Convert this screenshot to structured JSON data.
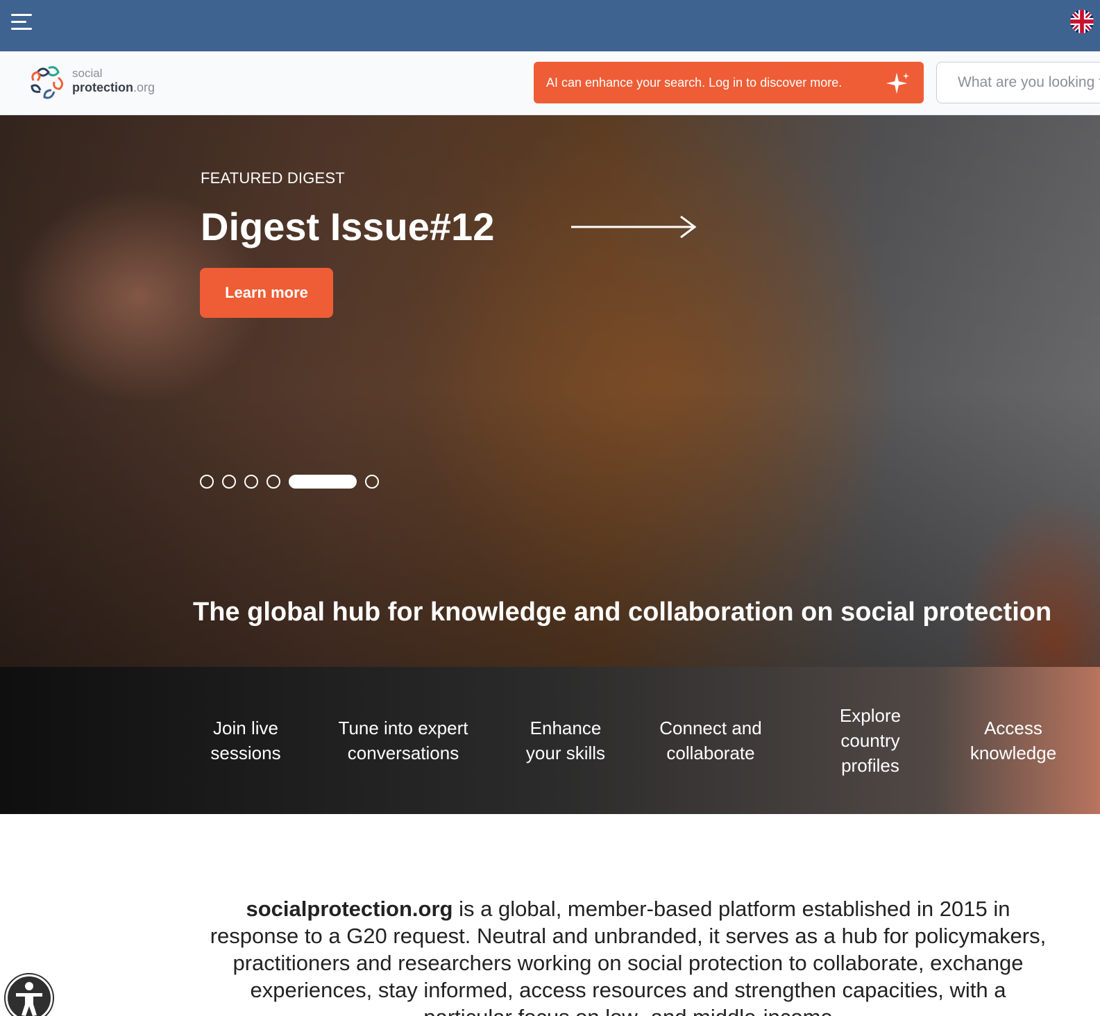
{
  "topbar": {
    "menu_icon": "hamburger-menu-icon",
    "language_icon": "uk-flag-icon",
    "colors": {
      "background": "#3e6390"
    }
  },
  "header": {
    "logo": {
      "line1": "social",
      "line2": "protection",
      "tld": ".org"
    },
    "ai_banner": {
      "text": "AI can enhance your search. Log in to discover more.",
      "icon": "sparkle-icon"
    },
    "search": {
      "placeholder": "What are you looking for?"
    },
    "colors": {
      "accent": "#ee5d35"
    }
  },
  "hero": {
    "kicker": "FEATURED DIGEST",
    "title": "Digest Issue#12",
    "arrow_icon": "arrow-right-icon",
    "learn_more_label": "Learn more",
    "carousel": {
      "slides": 6,
      "active_index": 4
    },
    "tagline": "The global hub for knowledge and collaboration on social protection"
  },
  "features": [
    {
      "line1": "Join live",
      "line2": "sessions"
    },
    {
      "line1": "Tune into expert",
      "line2": "conversations"
    },
    {
      "line1": "Enhance",
      "line2": "your skills"
    },
    {
      "line1": "Connect and",
      "line2": "collaborate"
    },
    {
      "line1": "Explore",
      "line2": "country",
      "line3": "profiles"
    },
    {
      "line1": "Access",
      "line2": "knowledge"
    }
  ],
  "about": {
    "brand": "socialprotection.org",
    "text": " is a global, member-based platform established in 2015 in response to a G20 request. Neutral and unbranded, it serves as a hub for policymakers, practitioners and researchers working on social protection to collaborate, exchange experiences, stay informed, access resources and strengthen capacities, with a particular focus on low- and middle-income"
  },
  "accessibility": {
    "icon": "accessibility-icon"
  }
}
